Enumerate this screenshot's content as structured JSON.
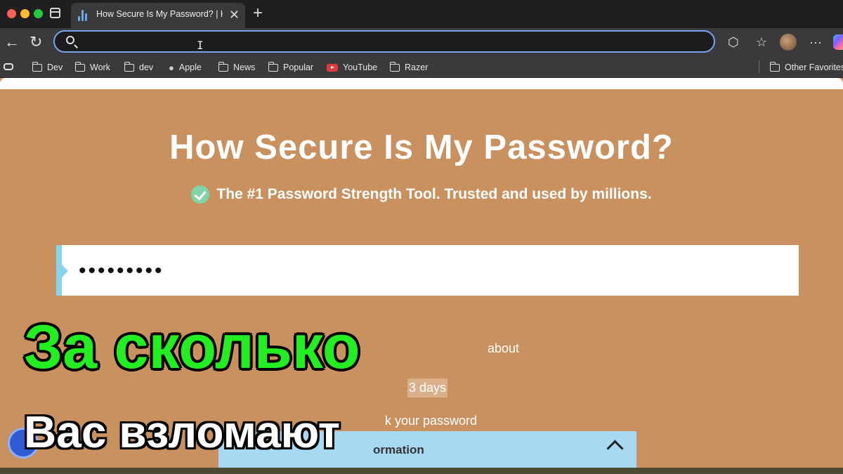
{
  "browser": {
    "tab_title": "How Secure Is My Password? | H",
    "tab_close_icon": "close-icon",
    "new_tab_icon": "plus-icon",
    "address_placeholder": "",
    "bookmarks": [
      "Dev",
      "Work",
      "dev",
      "Apple",
      "News",
      "Popular",
      "YouTube",
      "Razer"
    ],
    "other_favorites": "Other Favorites"
  },
  "page": {
    "title": "How Secure Is My Password?",
    "subtitle": "The #1 Password Strength Tool. Trusted and used by millions.",
    "password_value": "•••••••••",
    "result_fragment": "about",
    "days_fragment": "3 days",
    "check_fragment": "k your password",
    "info_fragment": "ormation"
  },
  "overlay": {
    "line1": "За сколько",
    "line2": "Вас взломают"
  },
  "colors": {
    "page_bg": "#c8915f",
    "caption_green": "#22ee22",
    "info_bar": "#a7d9f3",
    "accent_blue": "#86d3ee"
  }
}
